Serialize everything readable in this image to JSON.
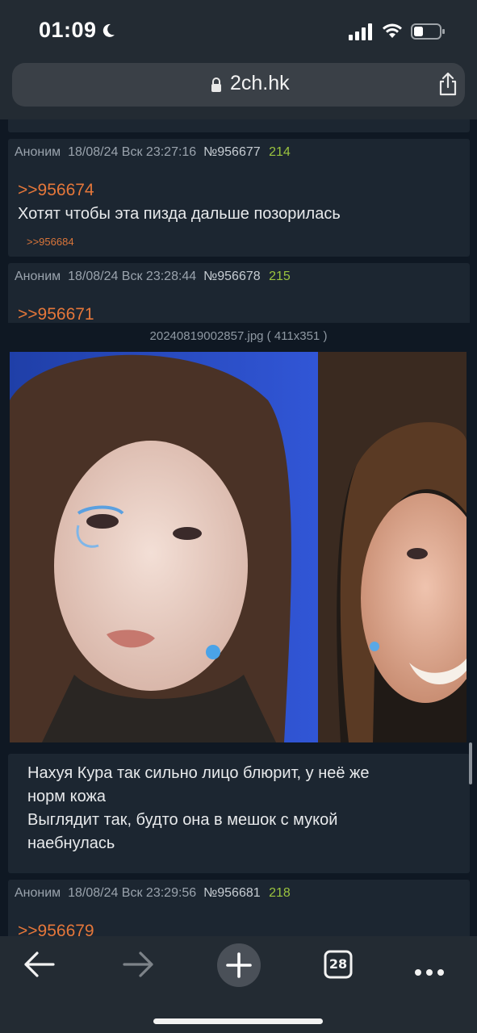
{
  "status_bar": {
    "time": "01:09"
  },
  "browser": {
    "url": "2ch.hk"
  },
  "posts": [
    {
      "author": "Аноним",
      "date": "18/08/24 Вск 23:27:16",
      "number": "№956677",
      "count": "214",
      "reply_to": ">>956674",
      "text": "Хотят чтобы эта пизда дальше позорилась",
      "backlink": ">>956684"
    },
    {
      "author": "Аноним",
      "date": "18/08/24 Вск 23:28:44",
      "number": "№956678",
      "count": "215",
      "reply_to": ">>956671"
    },
    {
      "text_lines": [
        "Нахуя Кура так сильно лицо блюрит, у неё же",
        "норм кожа",
        "Выглядит так, будто она в мешок с мукой",
        "наебнулась"
      ]
    },
    {
      "author": "Аноним",
      "date": "18/08/24 Вск 23:29:56",
      "number": "№956681",
      "count": "218",
      "reply_to": ">>956679"
    }
  ],
  "lightbox": {
    "caption": "20240819002857.jpg ( 411x351 )"
  },
  "toolbar": {
    "tabs_count": "28",
    "icons": [
      "back-arrow-icon",
      "forward-arrow-icon",
      "new-tab-plus-icon",
      "tabs-icon",
      "more-icon"
    ]
  },
  "colors": {
    "background": "#0f1823",
    "post_bg": "#1c2631",
    "reply_link": "#e5773a",
    "post_count": "#9bc43f",
    "chrome": "#232b33"
  }
}
